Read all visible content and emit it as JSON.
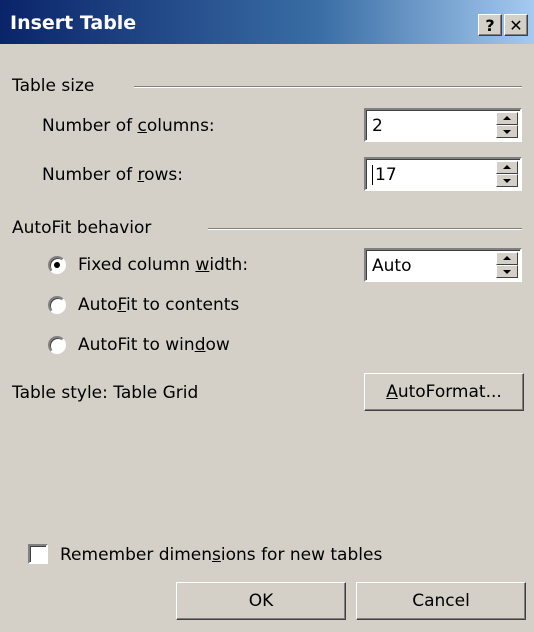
{
  "window": {
    "title": "Insert Table",
    "help_label": "?",
    "close_label": "✕"
  },
  "table_size": {
    "heading": "Table size",
    "columns": {
      "label_pre": "Number of ",
      "label_key": "c",
      "label_post": "olumns:",
      "value": "2"
    },
    "rows": {
      "label_pre": "Number of ",
      "label_key": "r",
      "label_post": "ows:",
      "value": "17"
    }
  },
  "autofit": {
    "heading": "AutoFit behavior",
    "options": [
      {
        "pre": "Fixed column ",
        "key": "w",
        "post": "idth:",
        "selected": true
      },
      {
        "pre": "Auto",
        "key": "F",
        "post": "it to contents",
        "selected": false
      },
      {
        "pre": "AutoFit to win",
        "key": "d",
        "post": "ow",
        "selected": false
      }
    ],
    "fixed_width_value": "Auto"
  },
  "table_style": {
    "label": "Table style:  Table Grid",
    "autoformat": {
      "key": "A",
      "post": "utoFormat..."
    }
  },
  "remember": {
    "pre": "Remember dimen",
    "key": "s",
    "post": "ions for new tables",
    "checked": false
  },
  "buttons": {
    "ok": "OK",
    "cancel": "Cancel"
  }
}
